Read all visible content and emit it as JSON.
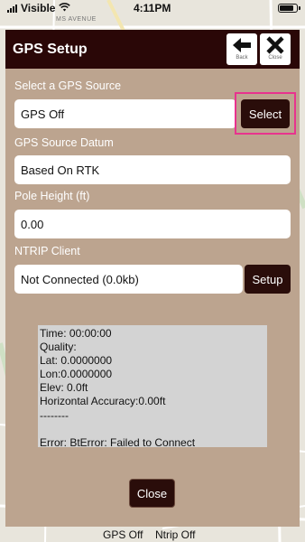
{
  "status_bar": {
    "carrier": "Visible",
    "time": "4:11PM"
  },
  "map": {
    "street_label": "MS AVENUE"
  },
  "dialog": {
    "title": "GPS Setup",
    "back_label": "Back",
    "close_label": "Close",
    "source_label": "Select a GPS Source",
    "source_value": "GPS Off",
    "select_button": "Select",
    "datum_label": "GPS Source Datum",
    "datum_value": "Based On RTK",
    "pole_label": "Pole Height (ft)",
    "pole_value": "0.00",
    "ntrip_label": "NTRIP Client",
    "ntrip_value": "Not Connected (0.0kb)",
    "setup_button": "Setup",
    "info_lines": [
      "Time: 00:00:00",
      "Quality:",
      "Lat: 0.0000000",
      "Lon:0.0000000",
      "Elev: 0.0ft",
      "Horizontal Accuracy:0.00ft",
      "--------",
      "",
      "Error: BtError: Failed to Connect"
    ],
    "close_button": "Close"
  },
  "bottom_status": {
    "gps": "GPS Off",
    "ntrip": "Ntrip Off"
  },
  "colors": {
    "header": "#2a0707",
    "dialog_bg": "#bca48f",
    "button_dark": "#2a0d0a",
    "highlight": "#e8338e"
  }
}
